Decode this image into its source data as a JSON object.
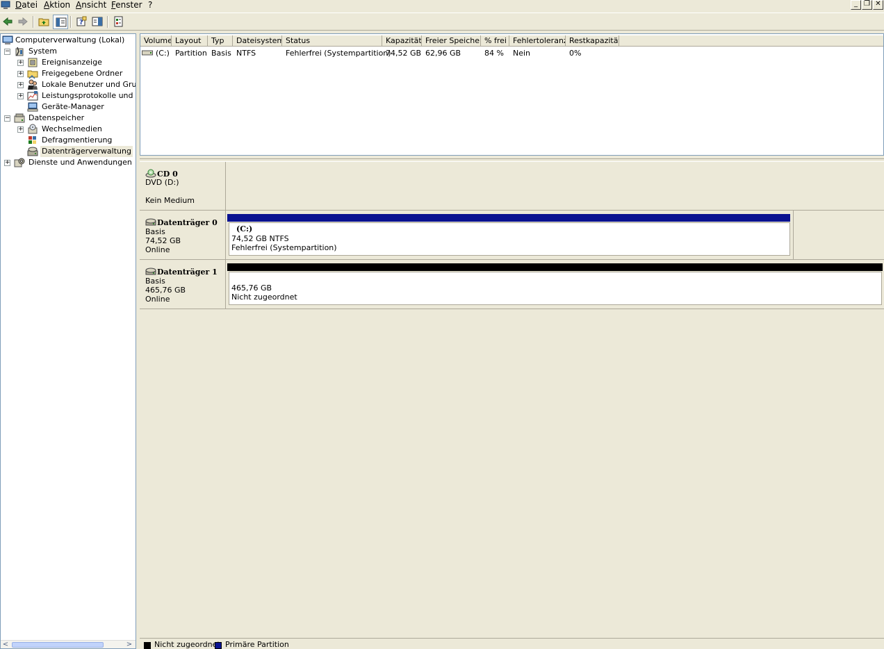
{
  "menu": {
    "items": [
      "Datei",
      "Aktion",
      "Ansicht",
      "Fenster",
      "?"
    ]
  },
  "window_controls": {
    "minimize": "_",
    "restore": "❐",
    "close": "✕"
  },
  "tree": {
    "root": "Computerverwaltung (Lokal)",
    "system": "System",
    "ereignisanzeige": "Ereignisanzeige",
    "freigegebene_ordner": "Freigegebene Ordner",
    "lokale_benutzer": "Lokale Benutzer und Gruppe",
    "leistungsprotokolle": "Leistungsprotokolle und War",
    "geraete_manager": "Geräte-Manager",
    "datenspeicher": "Datenspeicher",
    "wechselmedien": "Wechselmedien",
    "defragmentierung": "Defragmentierung",
    "datentraegerverwaltung": "Datenträgerverwaltung",
    "dienste": "Dienste und Anwendungen"
  },
  "volume_list": {
    "columns": [
      "Volume",
      "Layout",
      "Typ",
      "Dateisystem",
      "Status",
      "Kapazität",
      "Freier Speicher",
      "% frei",
      "Fehlertoleranz",
      "Restkapazität"
    ],
    "rows": [
      {
        "volume": "(C:)",
        "layout": "Partition",
        "typ": "Basis",
        "dateisystem": "NTFS",
        "status": "Fehlerfrei (Systempartition)",
        "kapazitaet": "74,52 GB",
        "frei": "62,96 GB",
        "prozent_frei": "84 %",
        "fehlertoleranz": "Nein",
        "restkapazitaet": "0%"
      }
    ]
  },
  "disks": [
    {
      "title": "CD 0",
      "lines": [
        "DVD (D:)",
        "",
        "Kein Medium"
      ]
    },
    {
      "title": "Datenträger 0",
      "lines": [
        "Basis",
        "74,52 GB",
        "Online"
      ],
      "partition": {
        "name": "(C:)",
        "size": "74,52 GB NTFS",
        "status": "Fehlerfrei (Systempartition)",
        "bar_color": "#0a1290"
      }
    },
    {
      "title": "Datenträger 1",
      "lines": [
        "Basis",
        "465,76 GB",
        "Online"
      ],
      "partition": {
        "name": "",
        "size": "465,76 GB",
        "status": "Nicht zugeordnet",
        "bar_color": "#000000"
      }
    }
  ],
  "legend": [
    {
      "label": "Nicht zugeordnet",
      "color": "#000000"
    },
    {
      "label": "Primäre Partition",
      "color": "#0a1290"
    }
  ]
}
